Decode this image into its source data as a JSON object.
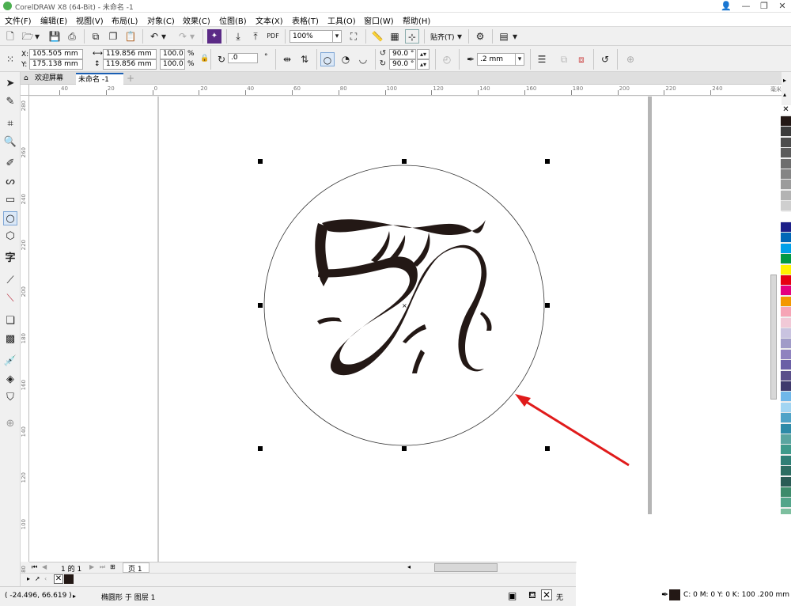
{
  "window": {
    "title": "CorelDRAW X8 (64-Bit) - 未命名 -1",
    "minimize": "—",
    "restore": "❐",
    "close": "✕",
    "help": "👤"
  },
  "menu": [
    "文件(F)",
    "编辑(E)",
    "视图(V)",
    "布局(L)",
    "对象(C)",
    "效果(C)",
    "位图(B)",
    "文本(X)",
    "表格(T)",
    "工具(O)",
    "窗口(W)",
    "帮助(H)"
  ],
  "toolbar": {
    "zoom": "100%",
    "snap_label": "贴齐(T)",
    "pdf_label": "PDF"
  },
  "property_bar": {
    "x_label": "X:",
    "x_value": "105.505 mm",
    "y_label": "Y:",
    "y_value": "175.138 mm",
    "width_value": "119.856 mm",
    "height_value": "119.856 mm",
    "scale_x": "100.0",
    "scale_y": "100.0",
    "percent": "%",
    "rotation": ".0",
    "degree": "°",
    "start_angle": "90.0 °",
    "end_angle": "90.0 °",
    "outline_width": ".2 mm"
  },
  "tabs": {
    "welcome": "欢迎屏幕",
    "document": "未命名 -1",
    "add": "+"
  },
  "ruler": {
    "h_ticks": [
      "40",
      "20",
      "0",
      "20",
      "40",
      "60",
      "80",
      "100",
      "120",
      "140",
      "160",
      "180",
      "200",
      "220",
      "240"
    ],
    "h_unit": "毫米",
    "v_ticks": [
      "280",
      "260",
      "240",
      "220",
      "200",
      "180",
      "160",
      "140",
      "120",
      "100",
      "80"
    ]
  },
  "page_nav": {
    "page_of": "1 的 1",
    "page_tab": "页 1"
  },
  "status": {
    "coords": "( -24.496, 66.619 )",
    "object_info": "椭圆形 于 图层 1",
    "fill_none": "无",
    "outline_info": "C: 0 M: 0 Y: 0 K: 100 .200 mm"
  },
  "colors": {
    "accent": "#1a5fb4",
    "arrow": "#e01b1b",
    "dragon": "#231815",
    "palette": [
      "#231815",
      "#3c3c3c",
      "#4d4d4d",
      "#5c5c5c",
      "#6e6e6e",
      "#858585",
      "#9c9c9c",
      "#b3b3b3",
      "#cfcfcf",
      "#ffffff",
      "#1d2088",
      "#0068b7",
      "#00a0e9",
      "#009944",
      "#fff100",
      "#e60012",
      "#e4007f",
      "#f39800",
      "#f6a5b6",
      "#f1c9d7",
      "#c9c3e0",
      "#a09bc8",
      "#8f83bf",
      "#6a5fa6",
      "#5a4f8a",
      "#3f3a6d",
      "#6fb7e9",
      "#a2d5f2",
      "#4fa3c7",
      "#2e8ba8",
      "#5aa5a0",
      "#3f9a8b",
      "#2f7f76",
      "#2c6d62",
      "#2a5b55",
      "#3d8b6b",
      "#53a58a",
      "#7dbf9f",
      "#a3d6ba"
    ]
  }
}
